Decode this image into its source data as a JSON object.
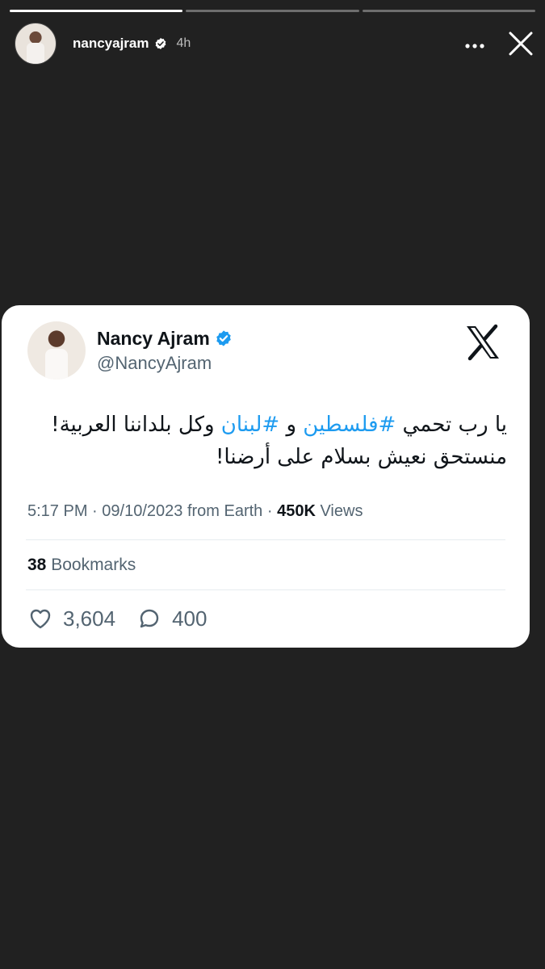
{
  "story": {
    "segments": [
      {
        "progress": 1.0
      },
      {
        "progress": 0.0
      },
      {
        "progress": 0.0
      }
    ],
    "username": "nancyajram",
    "time": "4h",
    "icons": {
      "verified": "verified-badge-icon",
      "more": "more-icon",
      "close": "close-icon"
    }
  },
  "tweet": {
    "display_name": "Nancy Ajram",
    "handle": "@NancyAjram",
    "text_line1_part1": "يا رب تحمي ",
    "hashtag1": "#فلسطين",
    "text_line1_part2": " و ",
    "hashtag2": "#لبنان",
    "text_line1_part3": " وكل بلداننا العربية!",
    "text_line2": "منستحق نعيش بسلام على أرضنا!",
    "time": "5:17 PM",
    "date": "09/10/2023",
    "source": "from Earth",
    "views_count": "450K",
    "views_label": "Views",
    "bookmarks_count": "38",
    "bookmarks_label": "Bookmarks",
    "likes": "3,604",
    "replies": "400",
    "icons": {
      "brand": "x-logo-icon",
      "like": "heart-icon",
      "reply": "comment-icon"
    }
  },
  "colors": {
    "background": "#212121",
    "card": "#ffffff",
    "accent": "#1d9bf0"
  }
}
